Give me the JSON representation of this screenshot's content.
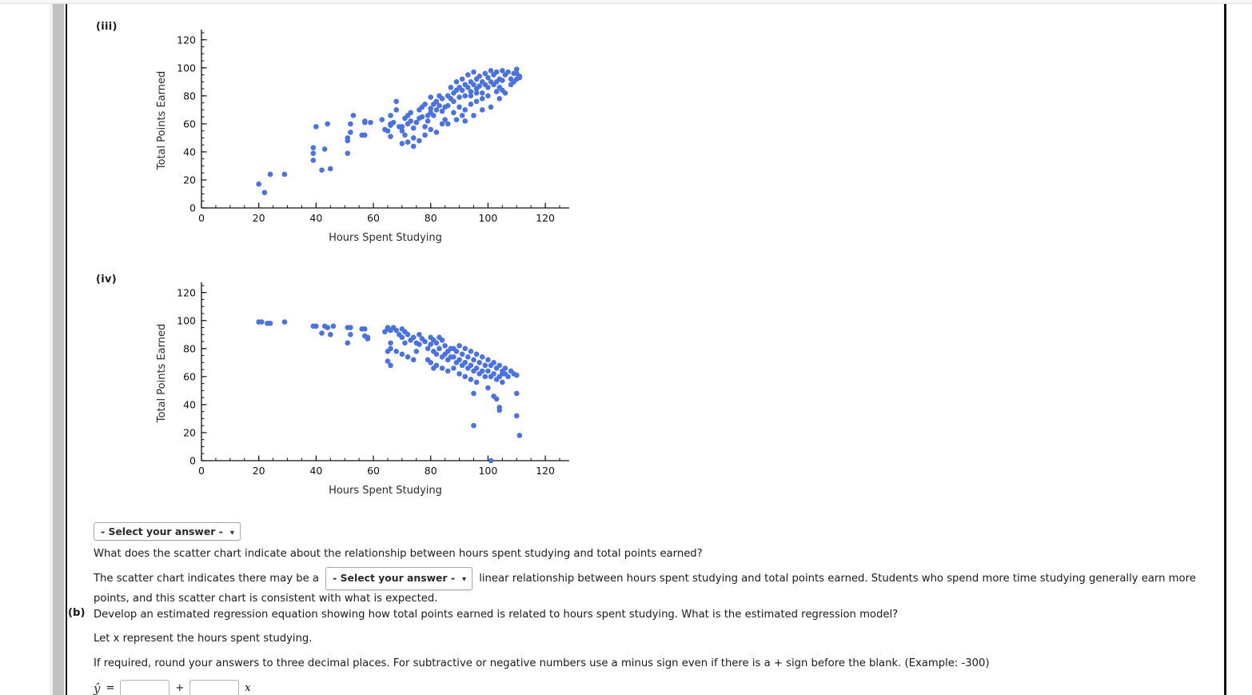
{
  "page": {
    "background": "#ffffff",
    "frame_border_color": "#111111",
    "scrollbar": {
      "track_color": "#f0f0f0",
      "thumb_color": "#c2c2c2"
    }
  },
  "charts": [
    {
      "part_label": "(iii)",
      "xlabel": "Hours  Spent  Studying",
      "ylabel": "Total  Points  Earned",
      "point_color": "#4a72e0"
    },
    {
      "part_label": "(iv)",
      "xlabel": "Hours  Spent  Studying",
      "ylabel": "Total  Points  Earned",
      "point_color": "#4a72e0"
    }
  ],
  "chart_data": [
    {
      "type": "scatter",
      "title": "(iii)",
      "xlabel": "Hours Spent Studying",
      "ylabel": "Total Points Earned",
      "xlim": [
        0,
        125
      ],
      "ylim": [
        0,
        125
      ],
      "xticks": [
        0,
        20,
        40,
        60,
        80,
        100,
        120
      ],
      "yticks": [
        0,
        20,
        40,
        60,
        80,
        100,
        120
      ],
      "minor_tick_step": 5,
      "grid": false,
      "legend": null,
      "marker_color": "#4a72e0",
      "relationship": "positive",
      "points": [
        [
          20,
          17
        ],
        [
          22,
          11
        ],
        [
          24,
          24
        ],
        [
          29,
          24
        ],
        [
          39,
          43
        ],
        [
          39,
          39
        ],
        [
          39,
          34
        ],
        [
          42,
          27
        ],
        [
          43,
          42
        ],
        [
          44,
          60
        ],
        [
          40,
          58
        ],
        [
          45,
          28
        ],
        [
          51,
          48
        ],
        [
          51,
          50
        ],
        [
          52,
          54
        ],
        [
          52,
          60
        ],
        [
          51,
          39
        ],
        [
          53,
          66
        ],
        [
          56,
          52
        ],
        [
          57,
          52
        ],
        [
          57,
          61
        ],
        [
          57,
          62
        ],
        [
          59,
          61
        ],
        [
          64,
          56
        ],
        [
          66,
          66
        ],
        [
          66,
          59
        ],
        [
          66,
          60
        ],
        [
          66,
          51
        ],
        [
          67,
          61
        ],
        [
          68,
          70
        ],
        [
          68,
          76
        ],
        [
          63,
          63
        ],
        [
          65,
          55
        ],
        [
          69,
          58
        ],
        [
          70,
          58
        ],
        [
          70,
          55
        ],
        [
          71,
          52
        ],
        [
          71,
          64
        ],
        [
          72,
          66
        ],
        [
          72,
          60
        ],
        [
          73,
          68
        ],
        [
          73,
          62
        ],
        [
          74,
          50
        ],
        [
          74,
          57
        ],
        [
          75,
          61
        ],
        [
          76,
          70
        ],
        [
          76,
          64
        ],
        [
          77,
          72
        ],
        [
          77,
          65
        ],
        [
          78,
          58
        ],
        [
          78,
          74
        ],
        [
          79,
          66
        ],
        [
          79,
          62
        ],
        [
          80,
          79
        ],
        [
          80,
          71
        ],
        [
          80,
          68
        ],
        [
          81,
          74
        ],
        [
          81,
          66
        ],
        [
          82,
          76
        ],
        [
          82,
          70
        ],
        [
          83,
          80
        ],
        [
          83,
          73
        ],
        [
          84,
          69
        ],
        [
          84,
          78
        ],
        [
          85,
          63
        ],
        [
          85,
          72
        ],
        [
          70,
          46
        ],
        [
          72,
          47
        ],
        [
          74,
          44
        ],
        [
          76,
          48
        ],
        [
          78,
          52
        ],
        [
          80,
          56
        ],
        [
          82,
          54
        ],
        [
          84,
          60
        ],
        [
          86,
          80
        ],
        [
          86,
          73
        ],
        [
          87,
          86
        ],
        [
          87,
          78
        ],
        [
          88,
          82
        ],
        [
          88,
          76
        ],
        [
          89,
          90
        ],
        [
          89,
          84
        ],
        [
          90,
          86
        ],
        [
          90,
          79
        ],
        [
          91,
          92
        ],
        [
          91,
          84
        ],
        [
          92,
          88
        ],
        [
          92,
          80
        ],
        [
          93,
          95
        ],
        [
          93,
          86
        ],
        [
          94,
          90
        ],
        [
          94,
          83
        ],
        [
          95,
          97
        ],
        [
          95,
          88
        ],
        [
          96,
          92
        ],
        [
          96,
          85
        ],
        [
          97,
          94
        ],
        [
          97,
          87
        ],
        [
          98,
          90
        ],
        [
          98,
          82
        ],
        [
          99,
          96
        ],
        [
          99,
          88
        ],
        [
          100,
          93
        ],
        [
          100,
          86
        ],
        [
          101,
          98
        ],
        [
          101,
          90
        ],
        [
          90,
          72
        ],
        [
          92,
          70
        ],
        [
          94,
          74
        ],
        [
          96,
          76
        ],
        [
          88,
          68
        ],
        [
          91,
          66
        ],
        [
          102,
          95
        ],
        [
          102,
          88
        ],
        [
          103,
          97
        ],
        [
          103,
          90
        ],
        [
          104,
          92
        ],
        [
          104,
          86
        ],
        [
          105,
          98
        ],
        [
          105,
          91
        ],
        [
          106,
          95
        ],
        [
          107,
          97
        ],
        [
          108,
          92
        ],
        [
          109,
          96
        ],
        [
          110,
          99
        ],
        [
          110,
          92
        ],
        [
          111,
          94
        ],
        [
          110,
          96
        ],
        [
          103,
          83
        ],
        [
          105,
          84
        ],
        [
          100,
          80
        ],
        [
          98,
          78
        ],
        [
          96,
          82
        ],
        [
          94,
          80
        ],
        [
          86,
          60
        ],
        [
          89,
          63
        ],
        [
          92,
          62
        ],
        [
          95,
          66
        ],
        [
          98,
          70
        ],
        [
          101,
          72
        ],
        [
          104,
          78
        ],
        [
          106,
          82
        ],
        [
          108,
          88
        ],
        [
          109,
          90
        ],
        [
          111,
          93
        ]
      ]
    },
    {
      "type": "scatter",
      "title": "(iv)",
      "xlabel": "Hours Spent Studying",
      "ylabel": "Total Points Earned",
      "xlim": [
        0,
        125
      ],
      "ylim": [
        0,
        125
      ],
      "xticks": [
        0,
        20,
        40,
        60,
        80,
        100,
        120
      ],
      "yticks": [
        0,
        20,
        40,
        60,
        80,
        100,
        120
      ],
      "minor_tick_step": 5,
      "grid": false,
      "legend": null,
      "marker_color": "#4a72e0",
      "relationship": "negative",
      "points": [
        [
          20,
          99
        ],
        [
          21,
          99
        ],
        [
          23,
          98
        ],
        [
          24,
          98
        ],
        [
          29,
          99
        ],
        [
          39,
          96
        ],
        [
          40,
          96
        ],
        [
          42,
          91
        ],
        [
          43,
          96
        ],
        [
          44,
          95
        ],
        [
          45,
          90
        ],
        [
          46,
          96
        ],
        [
          51,
          95
        ],
        [
          52,
          95
        ],
        [
          52,
          90
        ],
        [
          51,
          84
        ],
        [
          56,
          94
        ],
        [
          57,
          94
        ],
        [
          57,
          89
        ],
        [
          58,
          88
        ],
        [
          58,
          87
        ],
        [
          64,
          92
        ],
        [
          65,
          95
        ],
        [
          65,
          94
        ],
        [
          66,
          93
        ],
        [
          66,
          84
        ],
        [
          66,
          80
        ],
        [
          65,
          78
        ],
        [
          65,
          71
        ],
        [
          67,
          95
        ],
        [
          68,
          93
        ],
        [
          69,
          90
        ],
        [
          70,
          94
        ],
        [
          70,
          88
        ],
        [
          71,
          92
        ],
        [
          71,
          84
        ],
        [
          72,
          90
        ],
        [
          73,
          86
        ],
        [
          74,
          88
        ],
        [
          75,
          84
        ],
        [
          76,
          90
        ],
        [
          76,
          83
        ],
        [
          77,
          87
        ],
        [
          78,
          85
        ],
        [
          79,
          80
        ],
        [
          68,
          78
        ],
        [
          70,
          76
        ],
        [
          72,
          74
        ],
        [
          74,
          72
        ],
        [
          75,
          78
        ],
        [
          66,
          68
        ],
        [
          80,
          88
        ],
        [
          80,
          83
        ],
        [
          81,
          86
        ],
        [
          81,
          78
        ],
        [
          82,
          84
        ],
        [
          82,
          76
        ],
        [
          83,
          88
        ],
        [
          83,
          80
        ],
        [
          84,
          74
        ],
        [
          84,
          86
        ],
        [
          85,
          82
        ],
        [
          85,
          76
        ],
        [
          86,
          78
        ],
        [
          86,
          72
        ],
        [
          87,
          80
        ],
        [
          87,
          74
        ],
        [
          80,
          70
        ],
        [
          82,
          68
        ],
        [
          84,
          66
        ],
        [
          86,
          64
        ],
        [
          79,
          72
        ],
        [
          81,
          66
        ],
        [
          88,
          80
        ],
        [
          88,
          74
        ],
        [
          89,
          78
        ],
        [
          89,
          70
        ],
        [
          90,
          82
        ],
        [
          90,
          72
        ],
        [
          91,
          76
        ],
        [
          91,
          68
        ],
        [
          92,
          80
        ],
        [
          92,
          70
        ],
        [
          93,
          74
        ],
        [
          93,
          66
        ],
        [
          94,
          78
        ],
        [
          94,
          68
        ],
        [
          95,
          72
        ],
        [
          95,
          64
        ],
        [
          96,
          76
        ],
        [
          96,
          66
        ],
        [
          97,
          70
        ],
        [
          97,
          62
        ],
        [
          98,
          74
        ],
        [
          98,
          64
        ],
        [
          99,
          68
        ],
        [
          99,
          60
        ],
        [
          90,
          62
        ],
        [
          92,
          60
        ],
        [
          94,
          58
        ],
        [
          96,
          56
        ],
        [
          88,
          66
        ],
        [
          95,
          48
        ],
        [
          95,
          25
        ],
        [
          100,
          72
        ],
        [
          100,
          64
        ],
        [
          101,
          68
        ],
        [
          101,
          60
        ],
        [
          102,
          70
        ],
        [
          102,
          62
        ],
        [
          103,
          66
        ],
        [
          103,
          58
        ],
        [
          104,
          68
        ],
        [
          104,
          60
        ],
        [
          105,
          64
        ],
        [
          105,
          56
        ],
        [
          106,
          66
        ],
        [
          106,
          62
        ],
        [
          107,
          60
        ],
        [
          100,
          52
        ],
        [
          102,
          46
        ],
        [
          103,
          44
        ],
        [
          104,
          38
        ],
        [
          104,
          36
        ],
        [
          105,
          62
        ],
        [
          108,
          64
        ],
        [
          109,
          62
        ],
        [
          110,
          61
        ],
        [
          110,
          48
        ],
        [
          110,
          32
        ],
        [
          111,
          18
        ],
        [
          101,
          0
        ]
      ]
    }
  ],
  "question": {
    "top_select": {
      "label": "- Select your answer -",
      "chevron": "chevron-down-icon"
    },
    "prompt": "What does the scatter chart indicate about the relationship between hours spent studying and total points earned?",
    "answer_prefix": "The scatter chart indicates there may be a",
    "inline_select": {
      "label": "- Select your answer -",
      "chevron": "chevron-down-icon"
    },
    "answer_suffix": "linear relationship between hours spent studying and total points earned. Students who spend more time studying generally earn more points, and this scatter chart is consistent with what is expected."
  },
  "part_b": {
    "marker": "(b)",
    "question": "Develop an estimated regression equation showing how total points earned is related to hours spent studying. What is the estimated regression model?",
    "let_line": "Let x represent the hours spent studying.",
    "rounding_note": "If required, round your answers to three decimal places. For subtractive or negative numbers use a minus sign even if there is a + sign before the blank. (Example: -300)",
    "equation": {
      "lhs": "ŷ",
      "equals": "=",
      "intercept_value": "",
      "plus": "+",
      "slope_value": "",
      "x_var": "x"
    }
  }
}
